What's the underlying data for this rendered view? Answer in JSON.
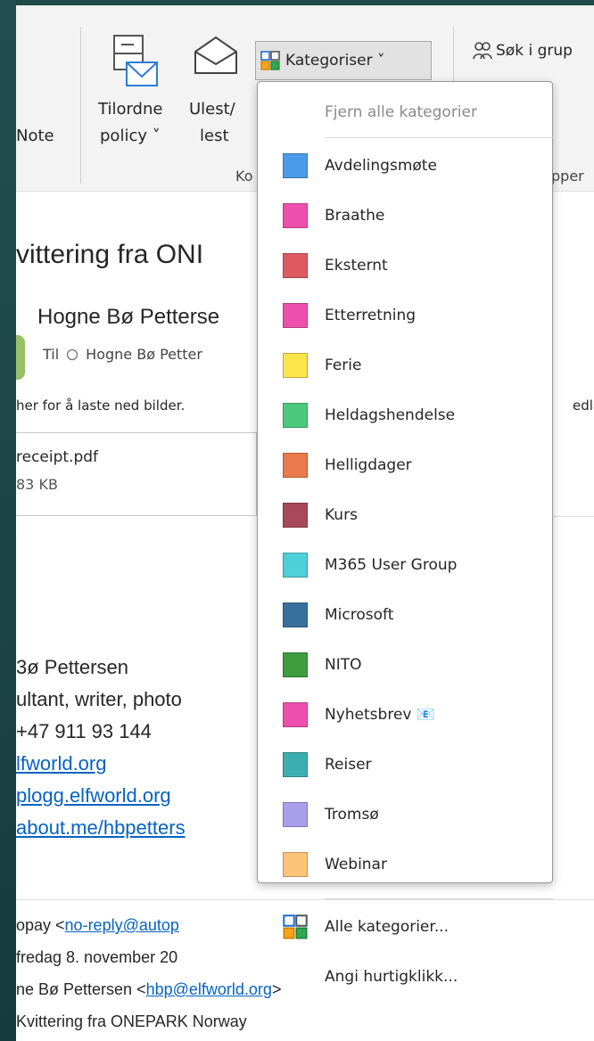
{
  "ribbon": {
    "note_label": "Note",
    "tilordne_line1": "Tilordne",
    "tilordne_line2": "policy ˅",
    "ulest_line1": "Ulest/",
    "ulest_line2": "lest",
    "kategoriser_label": "Kategoriser ˅",
    "search_groups_label": "Søk i grup",
    "group_label_left": "Ko",
    "group_label_right": "pper"
  },
  "email": {
    "subject": "vittering fra  ONI",
    "sender": "Hogne Bø Petterse",
    "to_prefix": "Til",
    "to_name": "Hogne Bø Petter",
    "info_bar": "her for å laste ned bilder.",
    "info_bar_right": "edla",
    "attachment_name": "receipt.pdf",
    "attachment_size": "83 KB",
    "signature": [
      {
        "text": "3ø Pettersen",
        "link": false
      },
      {
        "text": "ultant, writer, photo",
        "link": false
      },
      {
        "text": "+47 911 93 144",
        "link": false
      },
      {
        "text": "lfworld.org",
        "link": true
      },
      {
        "text": "plogg.elfworld.org",
        "link": true
      },
      {
        "text": "about.me/hbpetters",
        "link": true
      }
    ],
    "header_from_prefix": "opay <",
    "header_from_link": "no-reply@autop",
    "header_date": "fredag 8. november 20",
    "header_to_prefix": "ne Bø Pettersen <",
    "header_to_link": "hbp@elfworld.org",
    "header_to_suffix": ">",
    "header_subject": "Kvittering fra ONEPARK Norway"
  },
  "menu": {
    "clear_all": "Fjern alle kategorier",
    "categories": [
      {
        "name": "Avdelingsmøte",
        "color": "#4c9be8"
      },
      {
        "name": "Braathe",
        "color": "#ee4fad"
      },
      {
        "name": "Eksternt",
        "color": "#dd5a63"
      },
      {
        "name": "Etterretning",
        "color": "#ee4fad"
      },
      {
        "name": "Ferie",
        "color": "#fbe54a"
      },
      {
        "name": "Heldagshendelse",
        "color": "#4cc97e"
      },
      {
        "name": "Helligdager",
        "color": "#ea7a4b"
      },
      {
        "name": "Kurs",
        "color": "#a8495a"
      },
      {
        "name": "M365 User Group",
        "color": "#4dd0da"
      },
      {
        "name": "Microsoft",
        "color": "#38709d"
      },
      {
        "name": "NITO",
        "color": "#3f9c3f"
      },
      {
        "name": "Nyhetsbrev 📧",
        "color": "#ee4fad"
      },
      {
        "name": "Reiser",
        "color": "#3bafb0"
      },
      {
        "name": "Tromsø",
        "color": "#a99ee9"
      },
      {
        "name": "Webinar",
        "color": "#fcc37a"
      }
    ],
    "all_categories": "Alle kategorier...",
    "quick_click": "Angi hurtigklikk..."
  }
}
